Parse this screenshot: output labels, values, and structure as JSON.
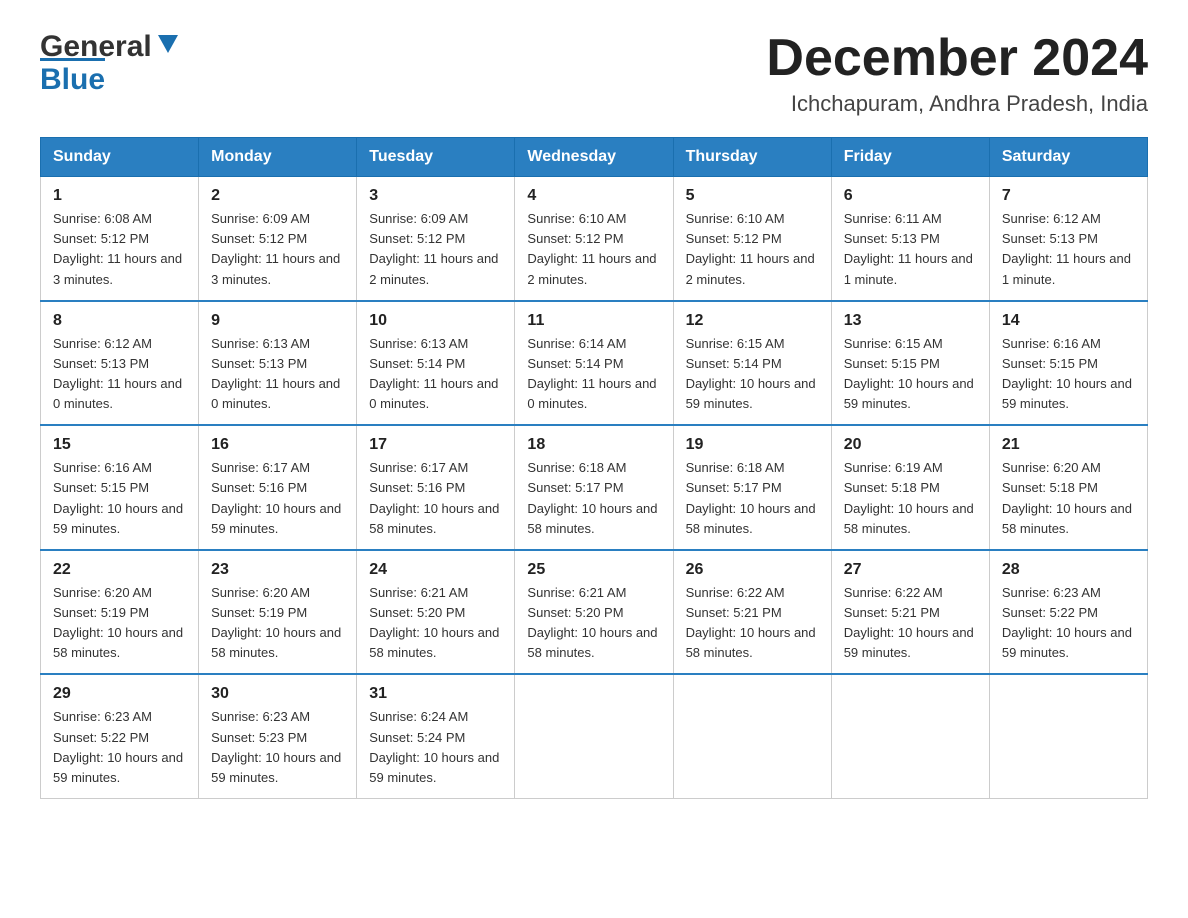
{
  "header": {
    "logo_general": "General",
    "logo_blue": "Blue",
    "month_title": "December 2024",
    "location": "Ichchapuram, Andhra Pradesh, India"
  },
  "weekdays": [
    "Sunday",
    "Monday",
    "Tuesday",
    "Wednesday",
    "Thursday",
    "Friday",
    "Saturday"
  ],
  "weeks": [
    [
      {
        "day": "1",
        "sunrise": "6:08 AM",
        "sunset": "5:12 PM",
        "daylight": "11 hours and 3 minutes."
      },
      {
        "day": "2",
        "sunrise": "6:09 AM",
        "sunset": "5:12 PM",
        "daylight": "11 hours and 3 minutes."
      },
      {
        "day": "3",
        "sunrise": "6:09 AM",
        "sunset": "5:12 PM",
        "daylight": "11 hours and 2 minutes."
      },
      {
        "day": "4",
        "sunrise": "6:10 AM",
        "sunset": "5:12 PM",
        "daylight": "11 hours and 2 minutes."
      },
      {
        "day": "5",
        "sunrise": "6:10 AM",
        "sunset": "5:12 PM",
        "daylight": "11 hours and 2 minutes."
      },
      {
        "day": "6",
        "sunrise": "6:11 AM",
        "sunset": "5:13 PM",
        "daylight": "11 hours and 1 minute."
      },
      {
        "day": "7",
        "sunrise": "6:12 AM",
        "sunset": "5:13 PM",
        "daylight": "11 hours and 1 minute."
      }
    ],
    [
      {
        "day": "8",
        "sunrise": "6:12 AM",
        "sunset": "5:13 PM",
        "daylight": "11 hours and 0 minutes."
      },
      {
        "day": "9",
        "sunrise": "6:13 AM",
        "sunset": "5:13 PM",
        "daylight": "11 hours and 0 minutes."
      },
      {
        "day": "10",
        "sunrise": "6:13 AM",
        "sunset": "5:14 PM",
        "daylight": "11 hours and 0 minutes."
      },
      {
        "day": "11",
        "sunrise": "6:14 AM",
        "sunset": "5:14 PM",
        "daylight": "11 hours and 0 minutes."
      },
      {
        "day": "12",
        "sunrise": "6:15 AM",
        "sunset": "5:14 PM",
        "daylight": "10 hours and 59 minutes."
      },
      {
        "day": "13",
        "sunrise": "6:15 AM",
        "sunset": "5:15 PM",
        "daylight": "10 hours and 59 minutes."
      },
      {
        "day": "14",
        "sunrise": "6:16 AM",
        "sunset": "5:15 PM",
        "daylight": "10 hours and 59 minutes."
      }
    ],
    [
      {
        "day": "15",
        "sunrise": "6:16 AM",
        "sunset": "5:15 PM",
        "daylight": "10 hours and 59 minutes."
      },
      {
        "day": "16",
        "sunrise": "6:17 AM",
        "sunset": "5:16 PM",
        "daylight": "10 hours and 59 minutes."
      },
      {
        "day": "17",
        "sunrise": "6:17 AM",
        "sunset": "5:16 PM",
        "daylight": "10 hours and 58 minutes."
      },
      {
        "day": "18",
        "sunrise": "6:18 AM",
        "sunset": "5:17 PM",
        "daylight": "10 hours and 58 minutes."
      },
      {
        "day": "19",
        "sunrise": "6:18 AM",
        "sunset": "5:17 PM",
        "daylight": "10 hours and 58 minutes."
      },
      {
        "day": "20",
        "sunrise": "6:19 AM",
        "sunset": "5:18 PM",
        "daylight": "10 hours and 58 minutes."
      },
      {
        "day": "21",
        "sunrise": "6:20 AM",
        "sunset": "5:18 PM",
        "daylight": "10 hours and 58 minutes."
      }
    ],
    [
      {
        "day": "22",
        "sunrise": "6:20 AM",
        "sunset": "5:19 PM",
        "daylight": "10 hours and 58 minutes."
      },
      {
        "day": "23",
        "sunrise": "6:20 AM",
        "sunset": "5:19 PM",
        "daylight": "10 hours and 58 minutes."
      },
      {
        "day": "24",
        "sunrise": "6:21 AM",
        "sunset": "5:20 PM",
        "daylight": "10 hours and 58 minutes."
      },
      {
        "day": "25",
        "sunrise": "6:21 AM",
        "sunset": "5:20 PM",
        "daylight": "10 hours and 58 minutes."
      },
      {
        "day": "26",
        "sunrise": "6:22 AM",
        "sunset": "5:21 PM",
        "daylight": "10 hours and 58 minutes."
      },
      {
        "day": "27",
        "sunrise": "6:22 AM",
        "sunset": "5:21 PM",
        "daylight": "10 hours and 59 minutes."
      },
      {
        "day": "28",
        "sunrise": "6:23 AM",
        "sunset": "5:22 PM",
        "daylight": "10 hours and 59 minutes."
      }
    ],
    [
      {
        "day": "29",
        "sunrise": "6:23 AM",
        "sunset": "5:22 PM",
        "daylight": "10 hours and 59 minutes."
      },
      {
        "day": "30",
        "sunrise": "6:23 AM",
        "sunset": "5:23 PM",
        "daylight": "10 hours and 59 minutes."
      },
      {
        "day": "31",
        "sunrise": "6:24 AM",
        "sunset": "5:24 PM",
        "daylight": "10 hours and 59 minutes."
      },
      null,
      null,
      null,
      null
    ]
  ],
  "labels": {
    "sunrise": "Sunrise:",
    "sunset": "Sunset:",
    "daylight": "Daylight:"
  }
}
